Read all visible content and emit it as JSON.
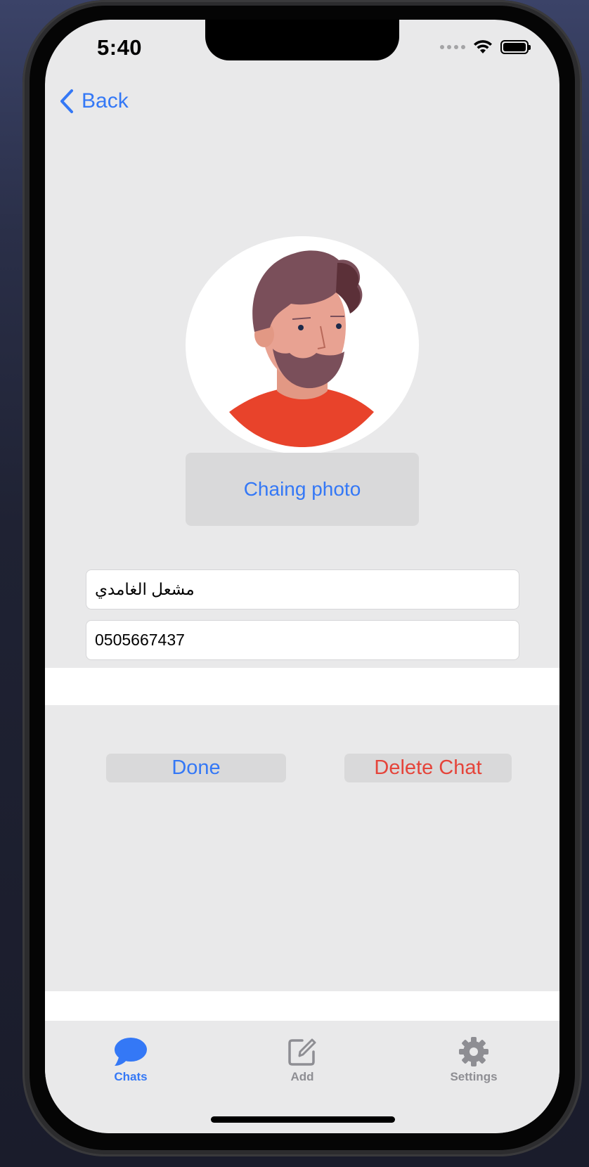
{
  "status_bar": {
    "time": "5:40"
  },
  "nav": {
    "back_label": "Back"
  },
  "profile": {
    "change_photo_label": "Chaing photo",
    "name_value": "مشعل الغامدي",
    "phone_value": "0505667437"
  },
  "actions": {
    "done_label": "Done",
    "delete_label": "Delete Chat"
  },
  "tab_bar": {
    "items": [
      {
        "label": "Chats",
        "icon": "chat-bubble-icon",
        "active": true
      },
      {
        "label": "Add",
        "icon": "compose-icon",
        "active": false
      },
      {
        "label": "Settings",
        "icon": "gear-icon",
        "active": false
      }
    ]
  },
  "colors": {
    "accent": "#3478f6",
    "destructive": "#e5443a",
    "background": "#e9e9ea",
    "button_fill": "#d9d9da"
  }
}
